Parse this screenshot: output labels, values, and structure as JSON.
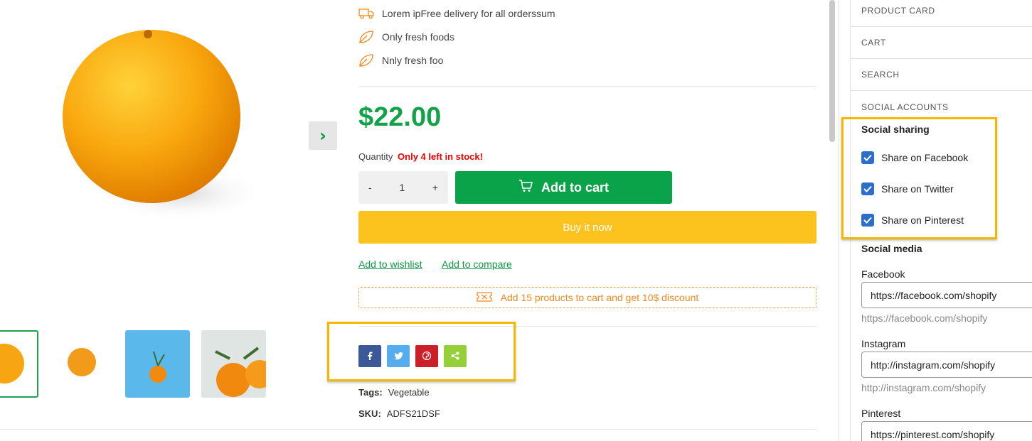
{
  "product": {
    "features": [
      {
        "icon": "truck-icon",
        "text": "Lorem ipFree delivery for all orderssum"
      },
      {
        "icon": "leaf-icon",
        "text": "Only fresh foods"
      },
      {
        "icon": "leaf-icon",
        "text": "Nnly fresh foo"
      }
    ],
    "price": "$22.00",
    "quantity_label": "Quantity",
    "stock_text": "Only 4 left in stock!",
    "quantity": {
      "minus": "-",
      "value": "1",
      "plus": "+"
    },
    "add_to_cart": "Add to cart",
    "buy_now": "Buy it now",
    "wishlist": "Add to wishlist",
    "compare": "Add to compare",
    "discount": "Add 15 products to cart and get 10$ discount",
    "next_arrow": "›",
    "tags_label": "Tags:",
    "tags_value": "Vegetable",
    "sku_label": "SKU:",
    "sku_value": "ADFS21DSF",
    "share_buttons": [
      {
        "name": "facebook",
        "glyph": "f",
        "color": "#3b5998"
      },
      {
        "name": "twitter",
        "glyph": "t",
        "color": "#55acee"
      },
      {
        "name": "pinterest",
        "glyph": "p",
        "color": "#cb2027"
      },
      {
        "name": "share",
        "glyph": "<",
        "color": "#95d03a"
      }
    ],
    "colors": {
      "green": "#0ba34a",
      "yellow": "#fcc31f",
      "orange": "#f08a1d",
      "stock_red": "#e00000"
    }
  },
  "sidebar": {
    "items": [
      "PRODUCT CARD",
      "CART",
      "SEARCH",
      "SOCIAL ACCOUNTS"
    ],
    "social_sharing": {
      "heading": "Social sharing",
      "options": [
        {
          "label": "Share on Facebook",
          "checked": true
        },
        {
          "label": "Share on Twitter",
          "checked": true
        },
        {
          "label": "Share on Pinterest",
          "checked": true
        }
      ]
    },
    "social_media": {
      "heading": "Social media",
      "fields": [
        {
          "label": "Facebook",
          "value": "https://facebook.com/shopify",
          "help": "https://facebook.com/shopify"
        },
        {
          "label": "Instagram",
          "value": "http://instagram.com/shopify",
          "help": "http://instagram.com/shopify"
        },
        {
          "label": "Pinterest",
          "value": "https://pinterest.com/shopify"
        }
      ]
    }
  }
}
